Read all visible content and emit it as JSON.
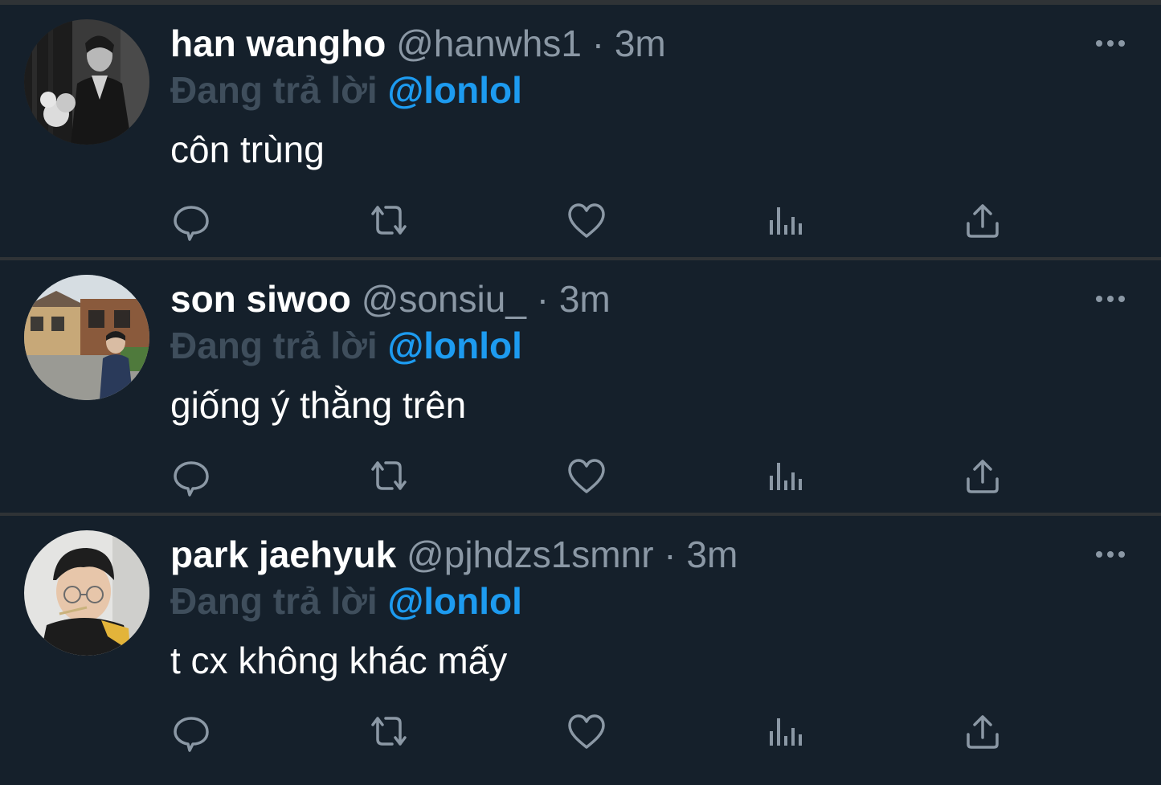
{
  "tweets": [
    {
      "display_name": "han wangho",
      "handle": "@hanwhs1",
      "separator": "·",
      "time": "3m",
      "reply_prefix": "Đang trả lời",
      "reply_to": "@lonlol",
      "text": "côn trùng",
      "avatar": "avatar-photo-grayscale-man-with-flowers"
    },
    {
      "display_name": "son siwoo",
      "handle": "@sonsiu_",
      "separator": "·",
      "time": "3m",
      "reply_prefix": "Đang trả lời",
      "reply_to": "@lonlol",
      "text": "giống ý thằng trên",
      "avatar": "avatar-photo-man-in-old-street"
    },
    {
      "display_name": "park jaehyuk",
      "handle": "@pjhdzs1smnr",
      "separator": "·",
      "time": "3m",
      "reply_prefix": "Đang trả lời",
      "reply_to": "@lonlol",
      "text": "t cx không khác mấy",
      "avatar": "avatar-photo-man-with-glasses"
    }
  ],
  "icons": {
    "more": "more-horizontal-icon",
    "reply": "reply-bubble-icon",
    "retweet": "retweet-icon",
    "like": "heart-icon",
    "analytics": "analytics-bars-icon",
    "share": "share-upload-icon"
  },
  "colors": {
    "background": "#15202b",
    "divider": "#2f3336",
    "secondary_text": "#8b98a5",
    "reply_prefix": "#3f4e5c",
    "mention": "#1d9bf0",
    "icon": "#8b98a5"
  }
}
